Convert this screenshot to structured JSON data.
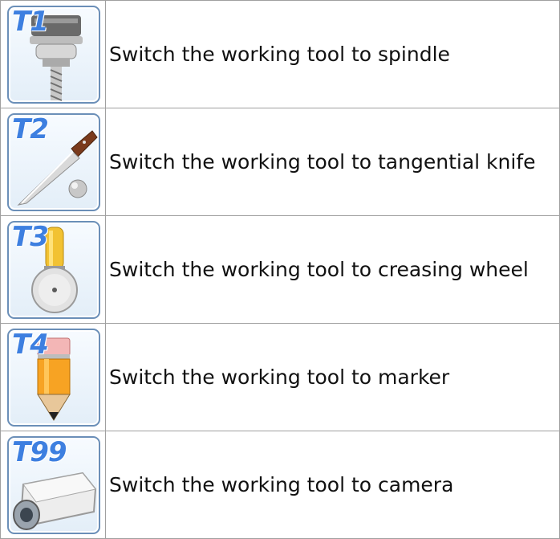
{
  "tools": [
    {
      "code": "T1",
      "description": "Switch the working tool to spindle",
      "icon": "spindle-icon"
    },
    {
      "code": "T2",
      "description": "Switch the working tool to tangential knife",
      "icon": "knife-icon"
    },
    {
      "code": "T3",
      "description": "Switch the working tool to creasing wheel",
      "icon": "creasing-wheel-icon"
    },
    {
      "code": "T4",
      "description": "Switch the working tool to marker",
      "icon": "pencil-marker-icon"
    },
    {
      "code": "T99",
      "description": "Switch the working tool to camera",
      "icon": "camera-icon"
    }
  ],
  "colors": {
    "label": "#3d7fe0",
    "frame_border": "#6b8fb8",
    "table_border": "#a0a0a0"
  }
}
